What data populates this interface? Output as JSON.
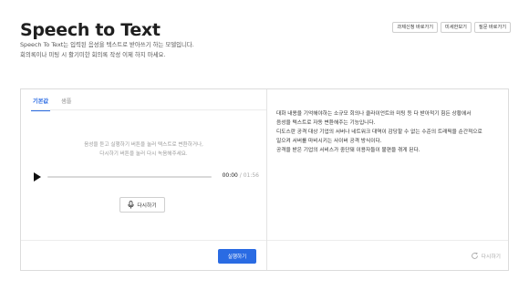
{
  "header": {
    "title": "Speech to Text",
    "description_line1": "Speech To Text는 입력된 음성을 텍스트로 받아쓰기 하는 모델입니다.",
    "description_line2": "회의록이나 미팅 시 활기미한 회의록 작성 이제 하지 마세요."
  },
  "top_actions": [
    {
      "label": "과제신청 바로가기"
    },
    {
      "label": "미세한보기"
    },
    {
      "label": "질문 바로가기"
    }
  ],
  "left_panel": {
    "tabs": [
      {
        "label": "기본값",
        "active": true
      },
      {
        "label": "샘플",
        "active": false
      }
    ],
    "hint_line1": "음성을 듣고 실행하기 버튼을 눌러 텍스트로 변환하거나,",
    "hint_line2": "다시하기 버튼을 눌러 다시 녹음해주세요.",
    "player": {
      "current_time": "00:00",
      "separator": " / ",
      "total_time": "01:56",
      "progress": 0
    },
    "rerecord_label": "다시하기",
    "run_label": "실행하기"
  },
  "right_panel": {
    "result_text": "대화 내용을 기억해야하는 소규모 회의나 클라이언트와 미팅 등 다 받아적기 힘든 상황에서\n음성을 텍스트로 자동 변환해주는 기능입니다.\n디도스란 공격 대상 기업의 서버나 네트워크 대역이 감당할 수 없는 수준의 트래픽을 순간적으로\n일으켜 서버를 마비시키는 사이버 공격 방식이다.\n공격을 받은 기업의 서비스가 중단돼 이용자들이 불편을 겪게 된다.",
    "retry_label": "다시하기"
  },
  "colors": {
    "accent": "#2a6be3",
    "muted": "#aaaaaa"
  },
  "icons": {
    "play": "play-icon",
    "mic": "mic-icon",
    "retry": "refresh-icon"
  }
}
